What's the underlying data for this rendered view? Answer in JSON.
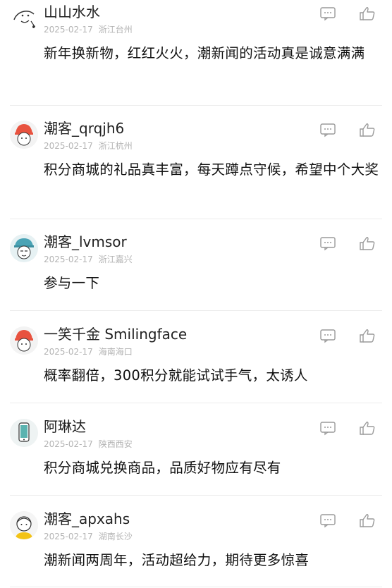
{
  "comments": [
    {
      "username": "山山水水",
      "date": "2025-02-17",
      "location": "浙江台州",
      "text": "新年换新物，红红火火，潮新闻的活动真是诚意满满",
      "avatar": "sketch-avatar-icon",
      "reply_icon": "comment-icon",
      "like_icon": "thumbs-up-icon"
    },
    {
      "username": "潮客_qrqjh6",
      "date": "2025-02-17",
      "location": "浙江杭州",
      "text": "积分商城的礼品真丰富，每天蹲点守候，希望中个大奖",
      "avatar": "red-hat-avatar-icon",
      "reply_icon": "comment-icon",
      "like_icon": "thumbs-up-icon"
    },
    {
      "username": "潮客_lvmsor",
      "date": "2025-02-17",
      "location": "浙江嘉兴",
      "text": "参与一下",
      "avatar": "teal-cap-avatar-icon",
      "reply_icon": "comment-icon",
      "like_icon": "thumbs-up-icon"
    },
    {
      "username": "一笑千金 Smilingface",
      "date": "2025-02-17",
      "location": "海南海口",
      "text": "概率翻倍，300积分就能试试手气，太诱人",
      "avatar": "red-hat-avatar-icon",
      "reply_icon": "comment-icon",
      "like_icon": "thumbs-up-icon"
    },
    {
      "username": "阿琳达",
      "date": "2025-02-17",
      "location": "陕西西安",
      "text": "积分商城兑换商品，品质好物应有尽有",
      "avatar": "phone-avatar-icon",
      "reply_icon": "comment-icon",
      "like_icon": "thumbs-up-icon"
    },
    {
      "username": "潮客_apxahs",
      "date": "2025-02-17",
      "location": "湖南长沙",
      "text": "潮新闻两周年，活动超给力，期待更多惊喜",
      "avatar": "yellow-avatar-icon",
      "reply_icon": "comment-icon",
      "like_icon": "thumbs-up-icon"
    }
  ]
}
